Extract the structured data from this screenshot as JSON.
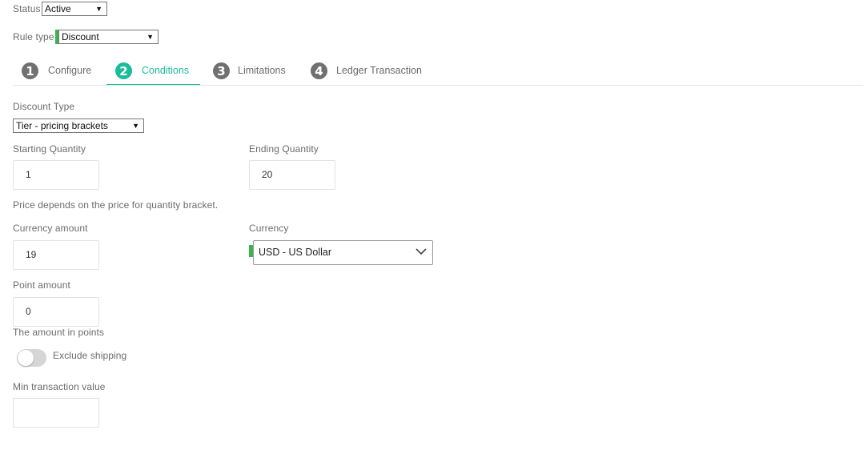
{
  "status": {
    "label": "Status",
    "value": "Active"
  },
  "rule_type": {
    "label": "Rule type",
    "value": "Discount"
  },
  "tabs": [
    {
      "number": "1",
      "label": "Configure",
      "active": false
    },
    {
      "number": "2",
      "label": "Conditions",
      "active": true
    },
    {
      "number": "3",
      "label": "Limitations",
      "active": false
    },
    {
      "number": "4",
      "label": "Ledger Transaction",
      "active": false
    }
  ],
  "discount_type": {
    "label": "Discount Type",
    "value": "Tier - pricing brackets"
  },
  "starting_quantity": {
    "label": "Starting Quantity",
    "value": "1"
  },
  "ending_quantity": {
    "label": "Ending Quantity",
    "value": "20"
  },
  "price_note": "Price depends on the price for quantity bracket.",
  "currency_amount": {
    "label": "Currency amount",
    "value": "19"
  },
  "currency": {
    "label": "Currency",
    "value": "USD - US Dollar"
  },
  "point_amount": {
    "label": "Point amount",
    "value": "0",
    "help": "The amount in points"
  },
  "exclude_shipping": {
    "label": "Exclude shipping",
    "enabled": false
  },
  "min_transaction_value": {
    "label": "Min transaction value",
    "value": ""
  },
  "colors": {
    "accent": "#1abc9c",
    "required_marker": "#3cb44b",
    "inactive_tab": "#707070"
  }
}
